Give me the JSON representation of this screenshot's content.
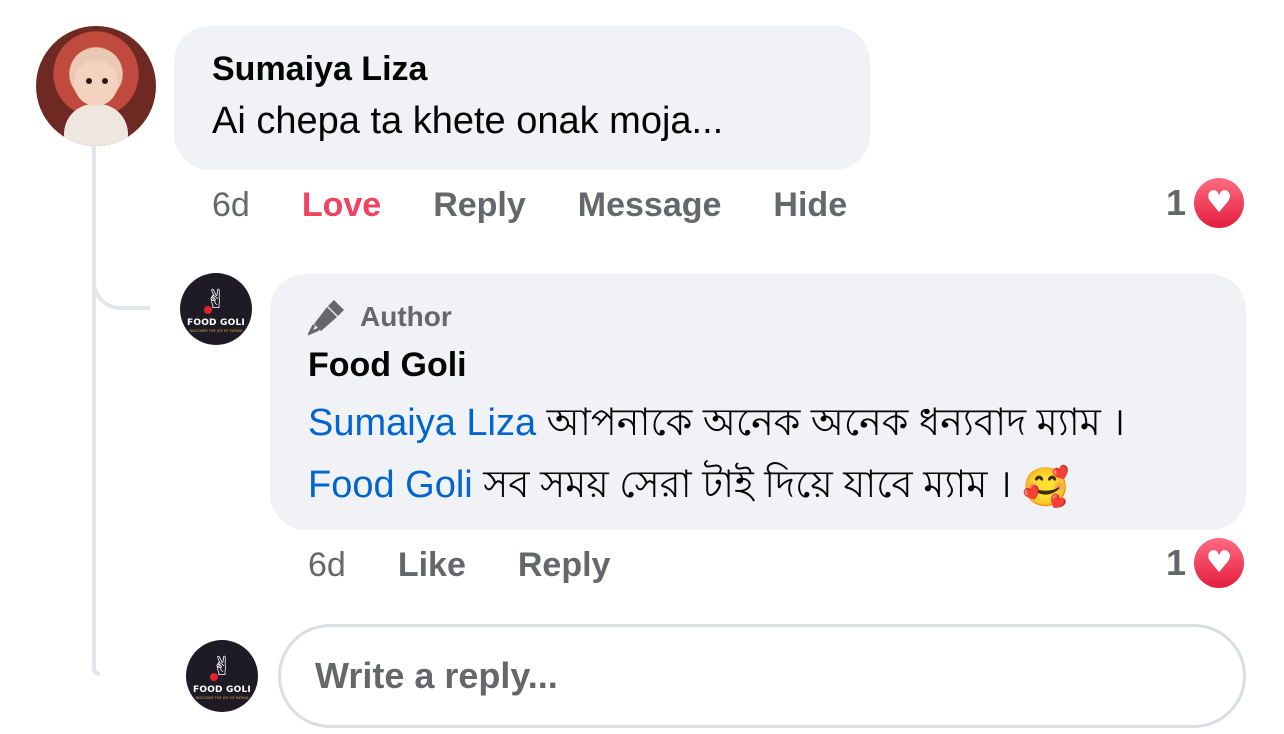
{
  "comment": {
    "author": "Sumaiya Liza",
    "text": "Ai chepa ta khete onak moja...",
    "time": "6d",
    "actions": [
      "Love",
      "Reply",
      "Message",
      "Hide"
    ],
    "reaction_count": "1",
    "reaction_icon": "heart-icon"
  },
  "reply": {
    "badge": "Author",
    "author": "Food Goli",
    "parts": [
      {
        "type": "mention",
        "text": "Sumaiya Liza"
      },
      {
        "type": "text",
        "text": " আপনাকে অনেক অনেক ধন্যবাদ ম্যাম । "
      },
      {
        "type": "mention",
        "text": "Food Goli"
      },
      {
        "type": "text",
        "text": " সব সময় সেরা টাই দিয়ে যাবে ম্যাম । "
      }
    ],
    "emoji": "🥰",
    "time": "6d",
    "actions": [
      "Like",
      "Reply"
    ],
    "reaction_count": "1"
  },
  "brand": {
    "logo_text": "FOOD GOLI",
    "tagline": "DISCOVER THE JOY OF EATING"
  },
  "reply_box": {
    "placeholder": "Write a reply..."
  },
  "colors": {
    "bubble": "#f0f2f5",
    "muted": "#65676b",
    "love": "#f3425f",
    "mention": "#0064d1"
  }
}
